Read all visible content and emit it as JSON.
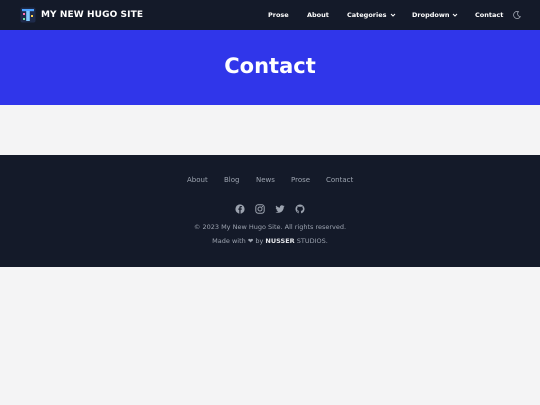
{
  "header": {
    "brand": "MY NEW HUGO SITE",
    "nav": [
      {
        "label": "Prose"
      },
      {
        "label": "About"
      },
      {
        "label": "Categories"
      },
      {
        "label": "Dropdown"
      },
      {
        "label": "Contact"
      }
    ],
    "logo_icon": "hugo-logo-icon",
    "theme_icon": "moon-icon"
  },
  "hero": {
    "title": "Contact"
  },
  "footer": {
    "links": [
      "About",
      "Blog",
      "News",
      "Prose",
      "Contact"
    ],
    "social_icons": [
      "facebook-icon",
      "instagram-icon",
      "twitter-icon",
      "github-icon"
    ],
    "copyright": "© 2023 My New Hugo Site. All rights reserved.",
    "made_prefix": "Made with",
    "made_heart": "❤",
    "made_by": "by",
    "made_brand": "NUSSER",
    "made_suffix": "STUDIOS."
  },
  "colors": {
    "header_bg": "#141a29",
    "hero_bg": "#3036ea",
    "page_bg": "#f4f4f5",
    "footer_text": "#9ca3af"
  }
}
